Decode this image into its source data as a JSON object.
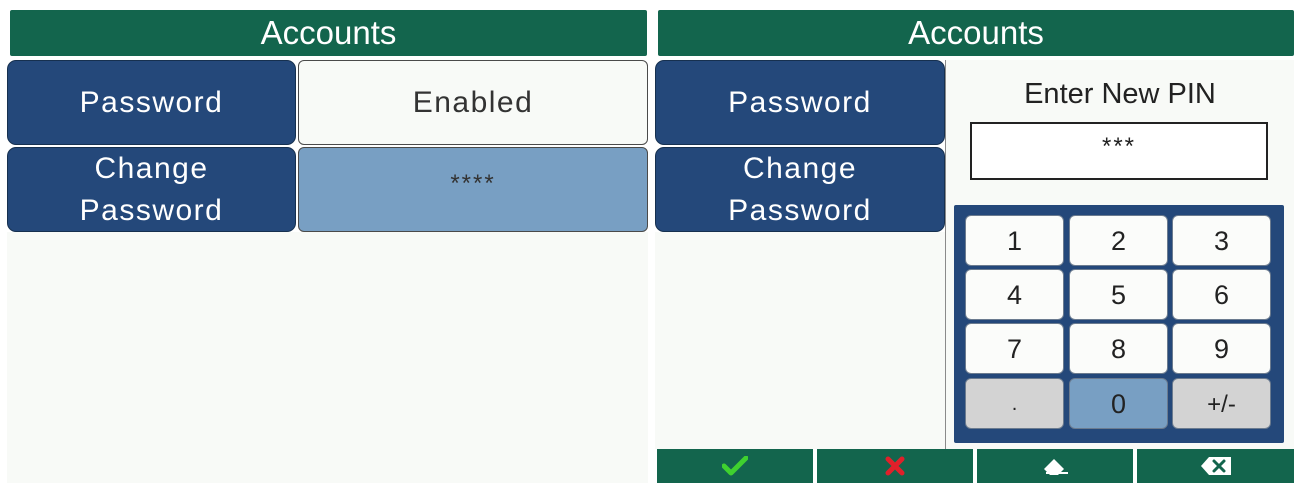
{
  "left": {
    "header": "Accounts",
    "password_label": "Password",
    "password_value": "Enabled",
    "change_password_line1": "Change",
    "change_password_line2": "Password",
    "change_password_value": "****"
  },
  "right": {
    "header": "Accounts",
    "password_label": "Password",
    "change_password_line1": "Change",
    "change_password_line2": "Password",
    "pin_prompt": "Enter New PIN",
    "pin_value": "***",
    "keypad": [
      "1",
      "2",
      "3",
      "4",
      "5",
      "6",
      "7",
      "8",
      "9",
      ".",
      "0",
      "+/-"
    ],
    "footer_icons": [
      "check-icon",
      "cross-icon",
      "eraser-icon",
      "backspace-icon"
    ]
  },
  "colors": {
    "header_green": "#13654d",
    "button_blue": "#24487a",
    "selected_blue": "#789fc3",
    "check_green": "#3fd12f",
    "cross_red": "#e0202a"
  }
}
